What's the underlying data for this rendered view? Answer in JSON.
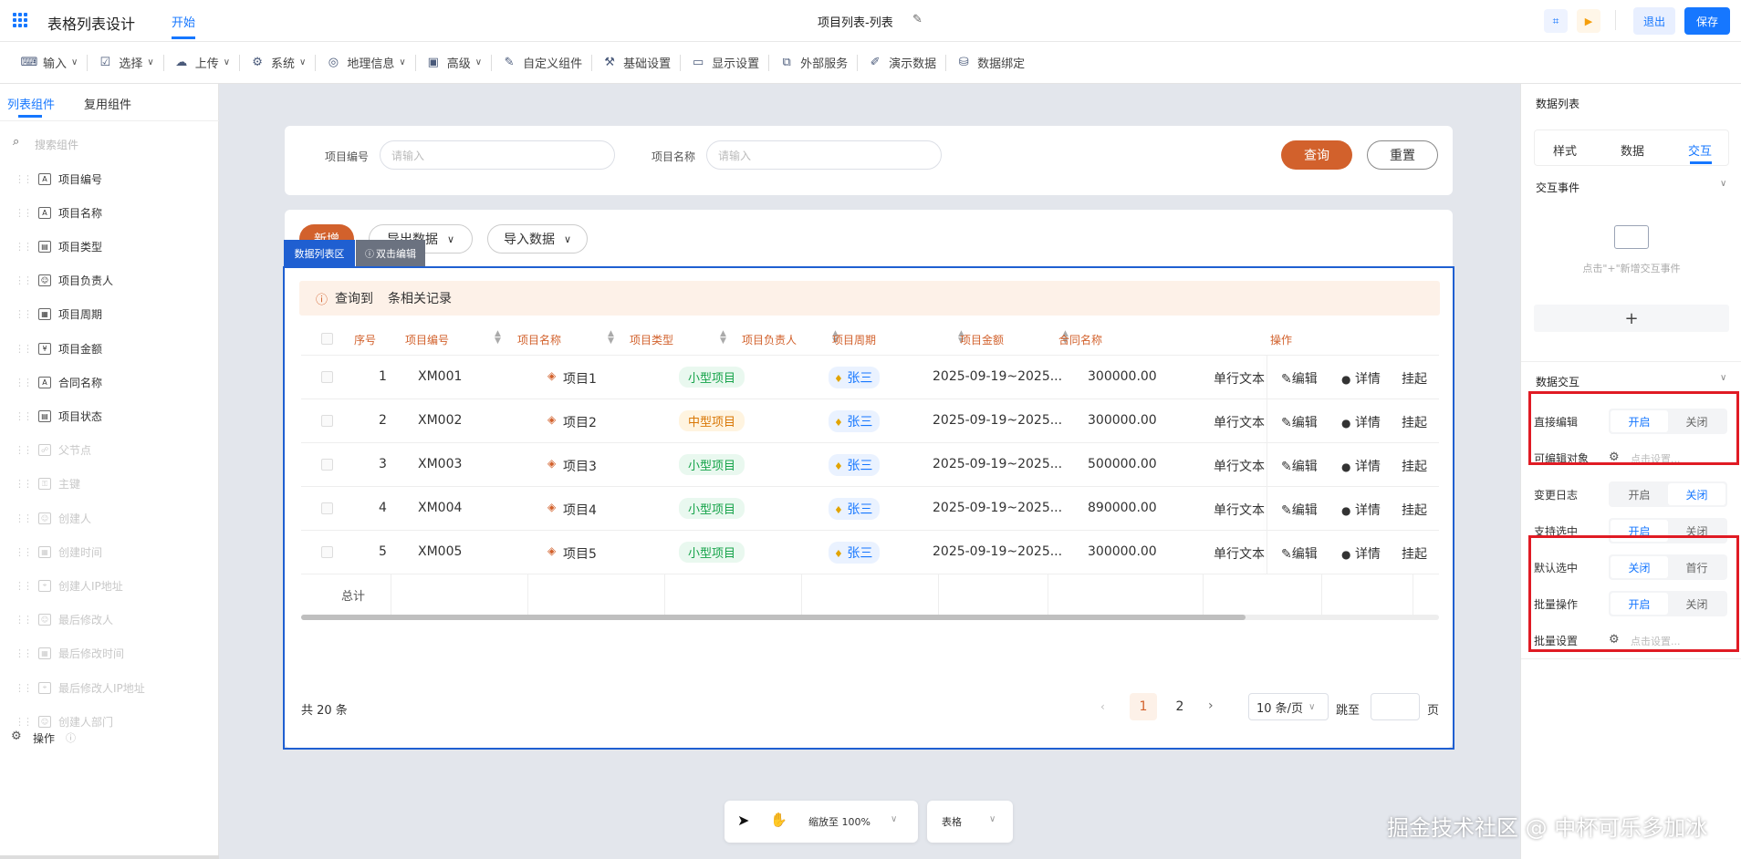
{
  "app": {
    "title": "表格列表设计",
    "tab": "开始",
    "doc_title": "项目列表-列表",
    "exit": "退出",
    "save": "保存"
  },
  "toolbar": [
    {
      "label": "输入",
      "icon": "input-icon",
      "dd": true
    },
    {
      "label": "选择",
      "icon": "select-icon",
      "dd": true
    },
    {
      "label": "上传",
      "icon": "upload-icon",
      "dd": true
    },
    {
      "label": "系统",
      "icon": "system-icon",
      "dd": true
    },
    {
      "label": "地理信息",
      "icon": "geo-icon",
      "dd": true
    },
    {
      "label": "高级",
      "icon": "advanced-icon",
      "dd": true
    },
    {
      "label": "自定义组件",
      "icon": "custom-icon",
      "dd": false
    },
    {
      "label": "基础设置",
      "icon": "base-settings-icon",
      "dd": false
    },
    {
      "label": "显示设置",
      "icon": "display-settings-icon",
      "dd": false
    },
    {
      "label": "外部服务",
      "icon": "external-service-icon",
      "dd": false
    },
    {
      "label": "演示数据",
      "icon": "demo-data-icon",
      "dd": false
    },
    {
      "label": "数据绑定",
      "icon": "data-binding-icon",
      "dd": false
    }
  ],
  "left": {
    "tabs": [
      "列表组件",
      "复用组件"
    ],
    "search_placeholder": "搜索组件",
    "items": [
      {
        "label": "项目编号",
        "enabled": true
      },
      {
        "label": "项目名称",
        "enabled": true
      },
      {
        "label": "项目类型",
        "enabled": true
      },
      {
        "label": "项目负责人",
        "enabled": true
      },
      {
        "label": "项目周期",
        "enabled": true
      },
      {
        "label": "项目金额",
        "enabled": true
      },
      {
        "label": "合同名称",
        "enabled": true
      },
      {
        "label": "项目状态",
        "enabled": true
      },
      {
        "label": "父节点",
        "enabled": false
      },
      {
        "label": "主键",
        "enabled": false
      },
      {
        "label": "创建人",
        "enabled": false
      },
      {
        "label": "创建时间",
        "enabled": false
      },
      {
        "label": "创建人IP地址",
        "enabled": false
      },
      {
        "label": "最后修改人",
        "enabled": false
      },
      {
        "label": "最后修改时间",
        "enabled": false
      },
      {
        "label": "最后修改人IP地址",
        "enabled": false
      },
      {
        "label": "创建人部门",
        "enabled": false
      }
    ],
    "ops_label": "操作"
  },
  "filter": {
    "code_label": "项目编号",
    "code_placeholder": "请输入",
    "name_label": "项目名称",
    "name_placeholder": "请输入",
    "query": "查询",
    "reset": "重置"
  },
  "actions": {
    "add": "新增",
    "export": "导出数据",
    "import": "导入数据"
  },
  "region": {
    "label": "数据列表区",
    "hint": "双击编辑"
  },
  "notice": {
    "prefix": "查询到",
    "suffix": "条相关记录"
  },
  "table": {
    "columns": [
      "序号",
      "项目编号",
      "项目名称",
      "项目类型",
      "项目负责人",
      "项目周期",
      "项目金额",
      "合同名称",
      "操作"
    ],
    "rows": [
      {
        "no": "1",
        "code": "XM001",
        "name": "项目1",
        "type": "小型项目",
        "type_kind": "small",
        "owner": "张三",
        "period": "2025-09-19~2025...",
        "amount": "300000.00",
        "contract": "单行文本"
      },
      {
        "no": "2",
        "code": "XM002",
        "name": "项目2",
        "type": "中型项目",
        "type_kind": "mid",
        "owner": "张三",
        "period": "2025-09-19~2025...",
        "amount": "300000.00",
        "contract": "单行文本"
      },
      {
        "no": "3",
        "code": "XM003",
        "name": "项目3",
        "type": "小型项目",
        "type_kind": "small",
        "owner": "张三",
        "period": "2025-09-19~2025...",
        "amount": "500000.00",
        "contract": "单行文本"
      },
      {
        "no": "4",
        "code": "XM004",
        "name": "项目4",
        "type": "小型项目",
        "type_kind": "small",
        "owner": "张三",
        "period": "2025-09-19~2025...",
        "amount": "890000.00",
        "contract": "单行文本"
      },
      {
        "no": "5",
        "code": "XM005",
        "name": "项目5",
        "type": "小型项目",
        "type_kind": "small",
        "owner": "张三",
        "period": "2025-09-19~2025...",
        "amount": "300000.00",
        "contract": "单行文本"
      }
    ],
    "row_actions": [
      "编辑",
      "详情",
      "挂起"
    ],
    "total_label": "总计"
  },
  "pager": {
    "total": "共 20 条",
    "pages": [
      "1",
      "2"
    ],
    "size": "10 条/页",
    "jump": "跳至",
    "page_unit": "页"
  },
  "bottom": {
    "zoom": "缩放至 100%",
    "view": "表格"
  },
  "right": {
    "title": "数据列表",
    "tabs": [
      "样式",
      "数据",
      "交互"
    ],
    "events_title": "交互事件",
    "events_empty": "点击\"+\"新增交互事件",
    "add": "+",
    "data_title": "数据交互",
    "rows": [
      {
        "label": "直接编辑",
        "a": "开启",
        "b": "关闭",
        "on": "a"
      },
      {
        "label": "可编辑对象",
        "placeholder": "点击设置..."
      },
      {
        "label": "变更日志",
        "a": "开启",
        "b": "关闭",
        "on": "b"
      },
      {
        "label": "支持选中",
        "a": "开启",
        "b": "关闭",
        "on": "a"
      },
      {
        "label": "默认选中",
        "a": "关闭",
        "b": "首行",
        "on": "a"
      },
      {
        "label": "批量操作",
        "a": "开启",
        "b": "关闭",
        "on": "a"
      },
      {
        "label": "批量设置",
        "placeholder": "点击设置..."
      }
    ]
  },
  "watermark": "掘金技术社区 @ 中杯可乐多加冰",
  "colors": {
    "accent": "#1677ff",
    "primary_btn": "#d2612c",
    "tag_small": "#16a34a",
    "tag_mid": "#d97706"
  }
}
